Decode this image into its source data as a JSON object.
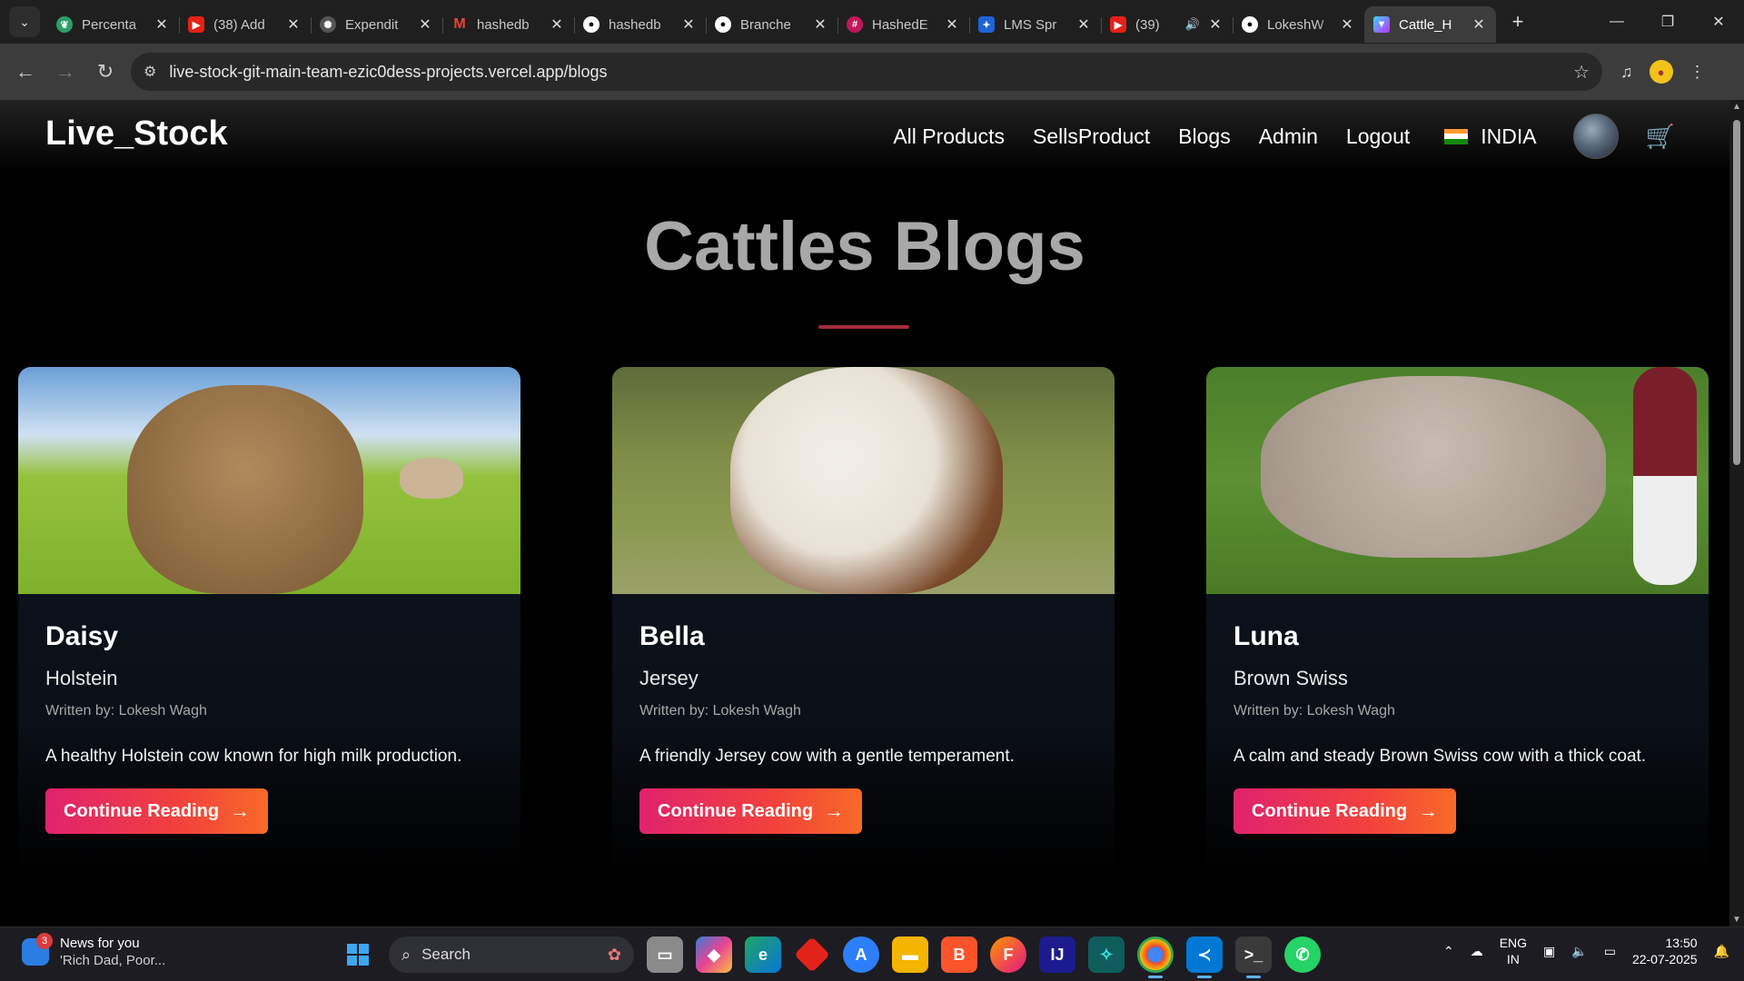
{
  "browser": {
    "tabs": [
      {
        "title": "Percenta",
        "icon": "leaf-icon",
        "color": "#2e9f6a"
      },
      {
        "title": "(38) Add",
        "icon": "youtube-icon",
        "color": "#e62117"
      },
      {
        "title": "Expendit",
        "icon": "openai-icon",
        "color": "#555555"
      },
      {
        "title": "hashedb",
        "icon": "gmail-icon",
        "color": "#d93025"
      },
      {
        "title": "hashedb",
        "icon": "github-icon",
        "color": "#ffffff"
      },
      {
        "title": "Branche",
        "icon": "github-icon",
        "color": "#ffffff"
      },
      {
        "title": "HashedE",
        "icon": "hashed-icon",
        "color": "#c2185b"
      },
      {
        "title": "LMS Spr",
        "icon": "lms-icon",
        "color": "#1e63d6"
      },
      {
        "title": "(39)",
        "icon": "youtube-icon",
        "color": "#e62117",
        "audio": true
      },
      {
        "title": "LokeshW",
        "icon": "github-icon",
        "color": "#ffffff"
      },
      {
        "title": "Cattle_H",
        "icon": "vite-icon",
        "color": "#9b6cf5",
        "active": true
      }
    ],
    "url": "live-stock-git-main-team-ezic0dess-projects.vercel.app/blogs"
  },
  "site": {
    "brand": "Live_Stock",
    "nav": [
      "All Products",
      "SellsProduct",
      "Blogs",
      "Admin",
      "Logout"
    ],
    "country": "INDIA",
    "heading": "Cattles Blogs",
    "accent": "#a22c3c"
  },
  "blogs": [
    {
      "name": "Daisy",
      "breed": "Holstein",
      "author": "Written by: Lokesh Wagh",
      "description": "A healthy Holstein cow known for high milk production.",
      "cta": "Continue Reading"
    },
    {
      "name": "Bella",
      "breed": "Jersey",
      "author": "Written by: Lokesh Wagh",
      "description": "A friendly Jersey cow with a gentle temperament.",
      "cta": "Continue Reading"
    },
    {
      "name": "Luna",
      "breed": "Brown Swiss",
      "author": "Written by: Lokesh Wagh",
      "description": "A calm and steady Brown Swiss cow with a thick coat.",
      "cta": "Continue Reading"
    }
  ],
  "taskbar": {
    "news_title": "News for you",
    "news_sub": "'Rich Dad, Poor...",
    "news_badge": "3",
    "search": "Search",
    "lang_top": "ENG",
    "lang_bottom": "IN",
    "time": "13:50",
    "date": "22-07-2025"
  }
}
